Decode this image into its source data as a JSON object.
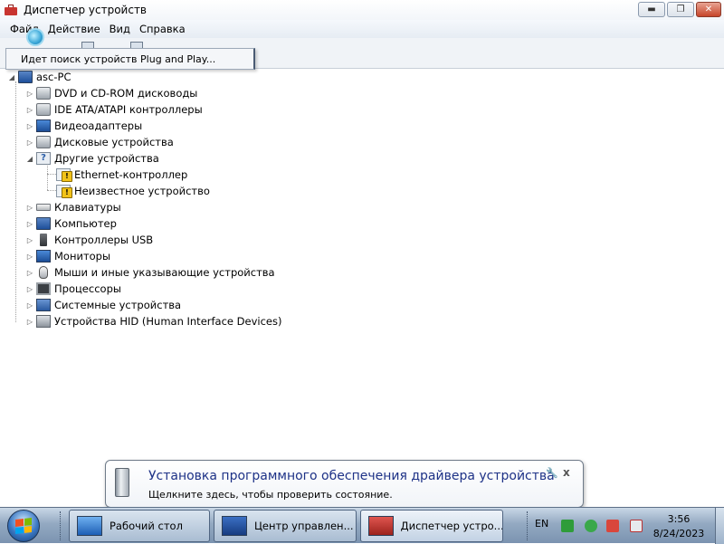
{
  "window": {
    "title": "Диспетчер устройств",
    "controls": {
      "minimize": "▬",
      "maximize": "❐",
      "close": "✕"
    }
  },
  "menu": [
    "Файл",
    "Действие",
    "Вид",
    "Справка"
  ],
  "search_tooltip": "Идет поиск устройств Plug and Play...",
  "tree": {
    "root": "asc-PC",
    "items": [
      {
        "label": "DVD и CD-ROM дисководы",
        "icon": "drive-icon",
        "expander": "▷"
      },
      {
        "label": "IDE ATA/ATAPI контроллеры",
        "icon": "ide-controller-icon",
        "expander": "▷"
      },
      {
        "label": "Видеоадаптеры",
        "icon": "video-adapter-icon",
        "expander": "▷"
      },
      {
        "label": "Дисковые устройства",
        "icon": "disk-icon",
        "expander": "▷"
      },
      {
        "label": "Другие устройства",
        "icon": "unknown-device-icon",
        "expander": "◢"
      },
      {
        "label": "Ethernet-контроллер",
        "icon": "warning-device-icon",
        "child": true
      },
      {
        "label": "Неизвестное устройство",
        "icon": "warning-device-icon",
        "child": true
      },
      {
        "label": "Клавиатуры",
        "icon": "keyboard-icon",
        "expander": "▷"
      },
      {
        "label": "Компьютер",
        "icon": "computer-icon",
        "expander": "▷"
      },
      {
        "label": "Контроллеры USB",
        "icon": "usb-icon",
        "expander": "▷"
      },
      {
        "label": "Мониторы",
        "icon": "monitor-icon",
        "expander": "▷"
      },
      {
        "label": "Мыши и иные указывающие устройства",
        "icon": "mouse-icon",
        "expander": "▷"
      },
      {
        "label": "Процессоры",
        "icon": "cpu-icon",
        "expander": "▷"
      },
      {
        "label": "Системные устройства",
        "icon": "system-device-icon",
        "expander": "▷"
      },
      {
        "label": "Устройства HID (Human Interface Devices)",
        "icon": "hid-icon",
        "expander": "▷"
      }
    ]
  },
  "balloon": {
    "title": "Установка программного обеспечения драйвера устройства",
    "text": "Щелкните здесь, чтобы проверить состояние.",
    "close": "x",
    "options": "🔧"
  },
  "taskbar": {
    "buttons": [
      {
        "label": "Рабочий стол",
        "icon": "desktop-icon"
      },
      {
        "label": "Центр управлен...",
        "icon": "network-center-icon"
      },
      {
        "label": "Диспетчер устро...",
        "icon": "device-manager-icon",
        "active": true
      }
    ],
    "language": "EN",
    "time": "3:56",
    "date": "8/24/2023"
  },
  "colors": {
    "accent": "#1e3287",
    "warning": "#f2c319",
    "taskbar": "#93a9c2"
  }
}
